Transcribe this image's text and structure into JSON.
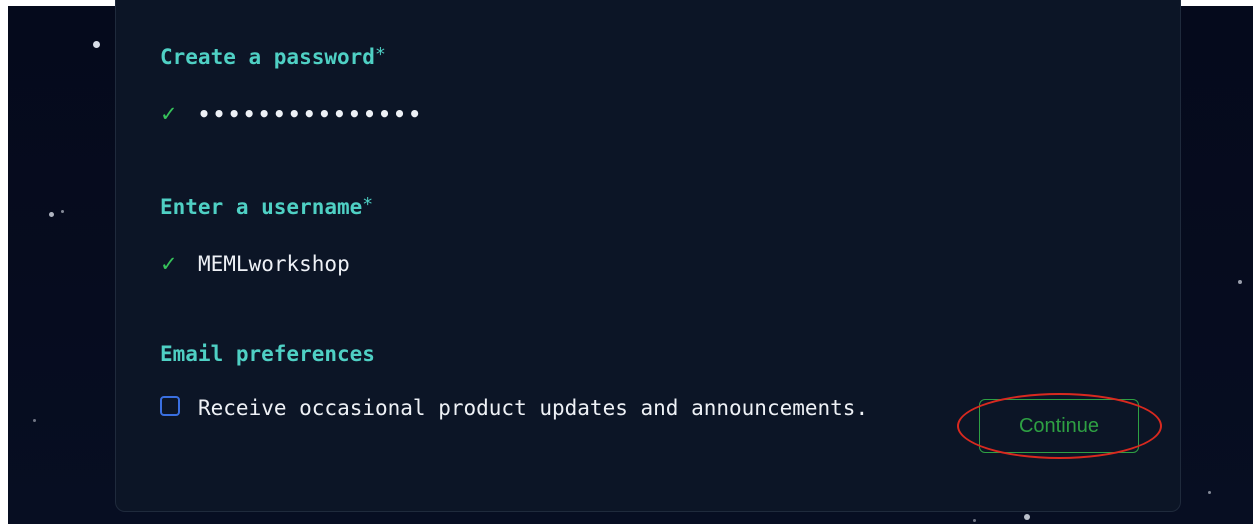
{
  "form": {
    "password": {
      "label": "Create a password",
      "required_mark": "*",
      "check_glyph": "✓",
      "masked_value": "•••••••••••••••"
    },
    "username": {
      "label": "Enter a username",
      "required_mark": "*",
      "check_glyph": "✓",
      "value": "MEMLworkshop"
    },
    "email_preferences": {
      "label": "Email preferences",
      "checkbox_checked": false,
      "checkbox_text": "Receive occasional product updates and announcements."
    },
    "continue_label": "Continue"
  },
  "colors": {
    "background": "#050a1c",
    "card": "#0c1526",
    "label": "#4fd0c4",
    "check": "#36c25a",
    "button": "#2ea043",
    "checkbox_border": "#3a6fe0",
    "annotation": "#d8291f"
  },
  "icons": {
    "valid": "check-icon",
    "checkbox": "checkbox-icon"
  }
}
